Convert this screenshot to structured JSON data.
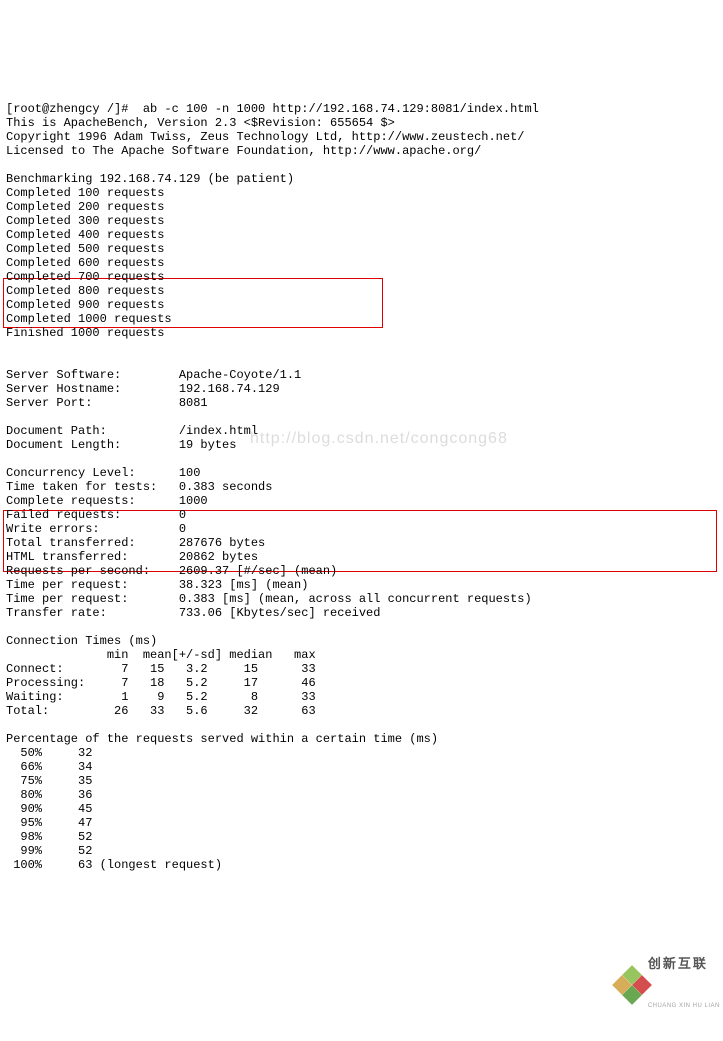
{
  "watermark": "http://blog.csdn.net/congcong68",
  "header": {
    "cmd": "[root@zhengcy /]#  ab -c 100 -n 1000 http://192.168.74.129:8081/index.html",
    "l1": "This is ApacheBench, Version 2.3 <$Revision: 655654 $>",
    "l2": "Copyright 1996 Adam Twiss, Zeus Technology Ltd, http://www.zeustech.net/",
    "l3": "Licensed to The Apache Software Foundation, http://www.apache.org/"
  },
  "bench": {
    "title": "Benchmarking 192.168.74.129 (be patient)",
    "c100": "Completed 100 requests",
    "c200": "Completed 200 requests",
    "c300": "Completed 300 requests",
    "c400": "Completed 400 requests",
    "c500": "Completed 500 requests",
    "c600": "Completed 600 requests",
    "c700": "Completed 700 requests",
    "c800": "Completed 800 requests",
    "c900": "Completed 900 requests",
    "c1000": "Completed 1000 requests",
    "fin": "Finished 1000 requests"
  },
  "server": {
    "software": "Server Software:        Apache-Coyote/1.1",
    "hostname": "Server Hostname:        192.168.74.129",
    "port": "Server Port:            8081"
  },
  "doc": {
    "path": "Document Path:          /index.html",
    "len": "Document Length:        19 bytes"
  },
  "stats": {
    "conc": "Concurrency Level:      100",
    "time": "Time taken for tests:   0.383 seconds",
    "comp": "Complete requests:      1000",
    "fail": "Failed requests:        0",
    "werr": "Write errors:           0",
    "total": "Total transferred:      287676 bytes",
    "html": "HTML transferred:       20862 bytes"
  },
  "perf": {
    "rps": "Requests per second:    2609.37 [#/sec] (mean)",
    "tpr1": "Time per request:       38.323 [ms] (mean)",
    "tpr2": "Time per request:       0.383 [ms] (mean, across all concurrent requests)",
    "rate": "Transfer rate:          733.06 [Kbytes/sec] received"
  },
  "conn": {
    "title": "Connection Times (ms)",
    "hdr": "              min  mean[+/-sd] median   max",
    "connect": "Connect:        7   15   3.2     15      33",
    "proc": "Processing:     7   18   5.2     17      46",
    "wait": "Waiting:        1    9   5.2      8      33",
    "total": "Total:         26   33   5.6     32      63"
  },
  "pct": {
    "title": "Percentage of the requests served within a certain time (ms)",
    "p50": "  50%     32",
    "p66": "  66%     34",
    "p75": "  75%     35",
    "p80": "  80%     36",
    "p90": "  90%     45",
    "p95": "  95%     47",
    "p98": "  98%     52",
    "p99": "  99%     52",
    "p100": " 100%     63 (longest request)"
  },
  "brand": {
    "name": "创新互联",
    "sub": "CHUANG XIN HU LIAN"
  }
}
